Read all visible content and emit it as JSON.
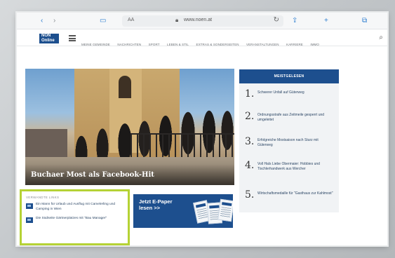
{
  "browser": {
    "url": "www.noen.at",
    "address_prefix": "AA"
  },
  "site": {
    "logo_text": "NÖN Online",
    "nav_items": [
      "MEINE GEMEINDE",
      "NACHRICHTEN",
      "SPORT",
      "LEBEN & STIL",
      "EXTRAS & SONDERSEITEN",
      "VERANSTALTUNGEN",
      "KARRIERE",
      "IMMO"
    ]
  },
  "hero": {
    "caption": "Buchaer Most als Facebook-Hit"
  },
  "most_read": {
    "heading": "MEISTGELESEN",
    "items": [
      {
        "num": "1.",
        "text": "Schwerer Unfall auf Güterweg"
      },
      {
        "num": "2.",
        "text": "Ordnungsstrafe aus Zeitmeile gesperrt und umgeleitet"
      },
      {
        "num": "3.",
        "text": "Erfolgreiche Mostsaison nach Sturz mit Güterweg"
      },
      {
        "num": "4.",
        "text": "Voll Hals Liebe Obermaier: Hobbies und Tischlerhandwerk aus Wercher"
      },
      {
        "num": "5.",
        "text": "Wirtschaftsmedaille für \"Gasthaus zur Kahlmost\""
      }
    ]
  },
  "related": {
    "heading": "VERWANDTE LINKS",
    "items": [
      {
        "text": "Ein Mann für Urlaub und Ausflug mit Camelerling und Camping in Wien"
      },
      {
        "text": "Die Südseite Gärtnerplatzes mit \"Bau Manager\""
      }
    ]
  },
  "epaper": {
    "title": "Jetzt E-Paper lesen >>"
  },
  "colors": {
    "brand_blue": "#1d4f8e",
    "highlight_green": "#b5d235"
  }
}
